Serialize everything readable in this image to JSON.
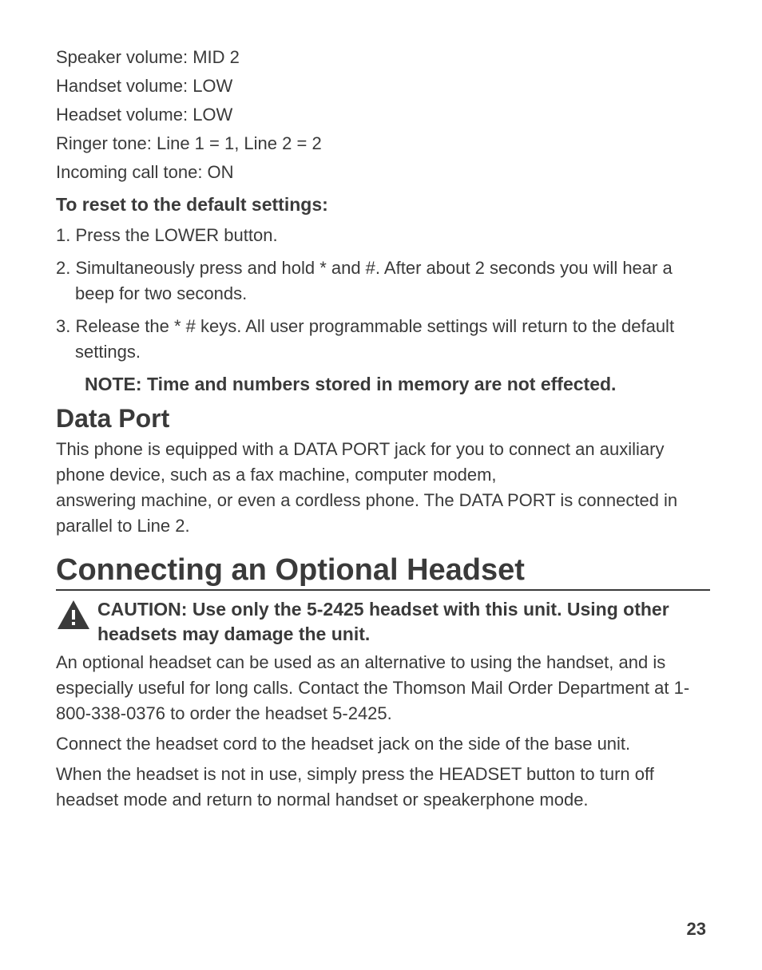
{
  "settings": {
    "speaker_volume": "Speaker volume: MID 2",
    "handset_volume": "Handset volume: LOW",
    "headset_volume": "Headset volume: LOW",
    "ringer_tone": "Ringer tone: Line 1 = 1, Line 2 = 2",
    "incoming_call_tone": "Incoming call tone: ON"
  },
  "reset": {
    "heading": "To reset to the default settings:",
    "steps": [
      "1. Press the LOWER button.",
      "2. Simultaneously press and hold * and #. After about 2 seconds you will hear a beep for two seconds.",
      "3. Release the * # keys. All user programmable settings will return to the default settings."
    ],
    "note": "NOTE: Time and numbers stored in memory are not effected."
  },
  "data_port": {
    "heading": "Data Port",
    "para1": "This phone is equipped with a DATA PORT jack for you to connect an auxiliary phone device, such as a fax machine, computer modem,",
    "para2": "answering machine, or even a cordless phone. The DATA PORT is connected in parallel to Line 2."
  },
  "headset_section": {
    "heading": "Connecting an Optional Headset",
    "caution": "CAUTION: Use only the 5-2425 headset with this unit. Using other headsets may damage the unit.",
    "para1": "An optional headset can be used as an alternative to using the handset, and is especially useful for long calls. Contact the Thomson Mail Order Department at 1-800-338-0376 to order the headset 5-2425.",
    "para2": "Connect the headset cord to the headset jack on the side of the base unit.",
    "para3": "When the headset is not in use, simply press the HEADSET button to turn off headset mode and return to normal handset or speakerphone mode."
  },
  "page_number": "23"
}
